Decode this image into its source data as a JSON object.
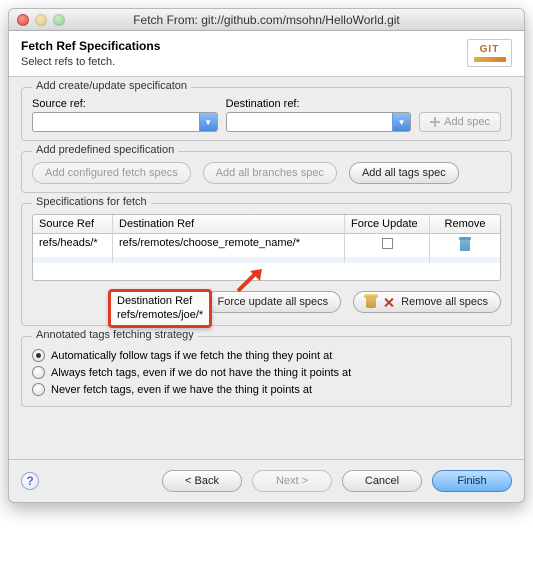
{
  "window": {
    "title": "Fetch From: git://github.com/msohn/HelloWorld.git"
  },
  "header": {
    "title": "Fetch Ref Specifications",
    "subtitle": "Select refs to fetch.",
    "logo": "GIT"
  },
  "create_box": {
    "legend": "Add create/update specificaton",
    "source_label": "Source ref:",
    "dest_label": "Destination ref:",
    "source_value": "",
    "dest_value": "",
    "add_spec_label": "Add spec"
  },
  "predefined_box": {
    "legend": "Add predefined specification",
    "configured_label": "Add configured fetch specs",
    "branches_label": "Add all branches spec",
    "tags_label": "Add all tags spec"
  },
  "specs_box": {
    "legend": "Specifications for fetch",
    "columns": {
      "src": "Source Ref",
      "dst": "Destination Ref",
      "force": "Force Update",
      "remove": "Remove"
    },
    "rows": [
      {
        "src": "refs/heads/*",
        "dst": "refs/remotes/choose_remote_name/*",
        "force": false
      }
    ],
    "callout": {
      "label": "Destination Ref",
      "value": "refs/remotes/joe/*"
    },
    "force_all_label": "Force update all specs",
    "remove_all_label": "Remove all specs"
  },
  "tags_box": {
    "legend": "Annotated tags fetching strategy",
    "options": [
      {
        "label": "Automatically follow tags if we fetch the thing they point at",
        "checked": true
      },
      {
        "label": "Always fetch tags, even if we do not have the thing it points at",
        "checked": false
      },
      {
        "label": "Never fetch tags, even if we have the thing it points at",
        "checked": false
      }
    ]
  },
  "footer": {
    "back": "< Back",
    "next": "Next >",
    "cancel": "Cancel",
    "finish": "Finish"
  }
}
